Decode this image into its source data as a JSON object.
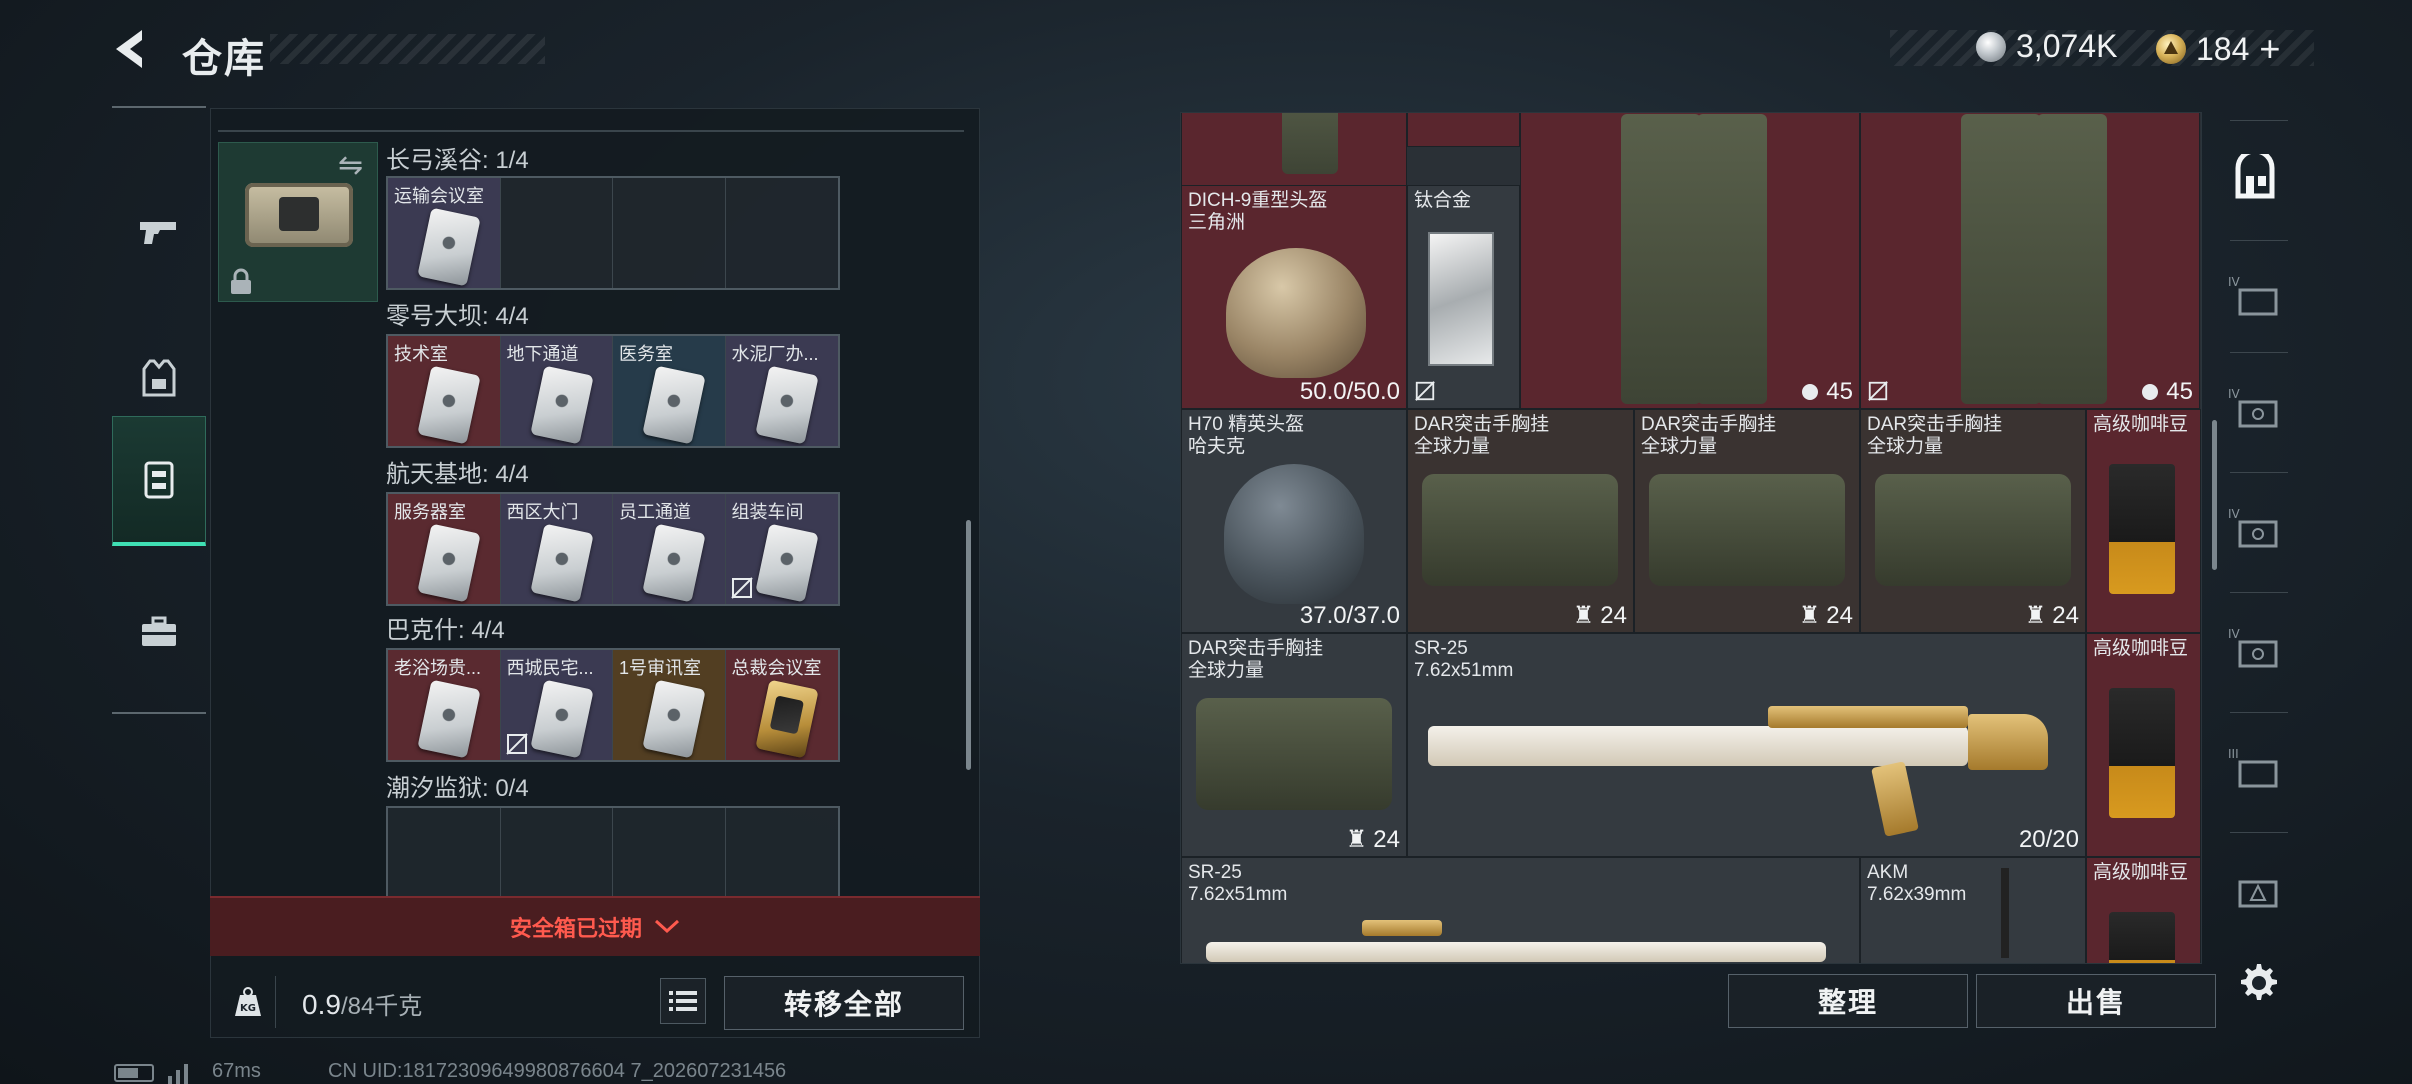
{
  "header": {
    "title": "仓库"
  },
  "currency": {
    "silver": "3,074K",
    "gold": "184",
    "gold_plus": "+"
  },
  "left_tabs": [
    "pistol-tab",
    "armor-tab",
    "safe-case-tab",
    "toolbox-tab"
  ],
  "maps": [
    {
      "label": "长弓溪谷: 1/4",
      "cells": [
        {
          "name": "运输会议室",
          "color": "purple"
        },
        {
          "name": "",
          "color": "empty"
        },
        {
          "name": "",
          "color": "empty"
        },
        {
          "name": "",
          "color": "empty"
        }
      ]
    },
    {
      "label": "零号大坝: 4/4",
      "cells": [
        {
          "name": "技术室",
          "color": "red"
        },
        {
          "name": "地下通道",
          "color": "purple"
        },
        {
          "name": "医务室",
          "color": "blue"
        },
        {
          "name": "水泥厂办...",
          "color": "purple"
        }
      ]
    },
    {
      "label": "航天基地: 4/4",
      "cells": [
        {
          "name": "服务器室",
          "color": "red"
        },
        {
          "name": "西区大门",
          "color": "purple"
        },
        {
          "name": "员工通道",
          "color": "purple"
        },
        {
          "name": "组装车间",
          "color": "purple"
        }
      ]
    },
    {
      "label": "巴克什: 4/4",
      "cells": [
        {
          "name": "老浴场贵...",
          "color": "red"
        },
        {
          "name": "西城民宅...",
          "color": "purple"
        },
        {
          "name": "1号审讯室",
          "color": "gold"
        },
        {
          "name": "总裁会议室",
          "color": "red"
        }
      ]
    },
    {
      "label": "潮汐监狱: 0/4",
      "cells": [
        {
          "name": "",
          "color": "empty"
        },
        {
          "name": "",
          "color": "empty"
        },
        {
          "name": "",
          "color": "empty"
        },
        {
          "name": "",
          "color": "empty"
        }
      ]
    }
  ],
  "expired": {
    "label": "安全箱已过期"
  },
  "weight": {
    "current": "0.9",
    "max": "/84千克",
    "kg_label": "KG"
  },
  "buttons": {
    "transfer_all": "转移全部",
    "sort": "整理",
    "sell": "出售"
  },
  "inventory": {
    "top_count_1": "45",
    "helmet1": {
      "name": "DICH-9重型头盔",
      "sub": "三角洲",
      "durability": "50.0/50.0"
    },
    "titanium": {
      "name": "钛合金"
    },
    "pants1": {
      "count": "45"
    },
    "pants2": {
      "count": "45"
    },
    "helmet2": {
      "name": "H70 精英头盔",
      "sub": "哈夫克",
      "durability": "37.0/37.0"
    },
    "rig1": {
      "name": "DAR突击手胸挂",
      "sub": "全球力量",
      "count": "24"
    },
    "rig2": {
      "name": "DAR突击手胸挂",
      "sub": "全球力量",
      "count": "24"
    },
    "rig3": {
      "name": "DAR突击手胸挂",
      "sub": "全球力量",
      "count": "24"
    },
    "coffee1": {
      "name": "高级咖啡豆"
    },
    "rig4": {
      "name": "DAR突击手胸挂",
      "sub": "全球力量",
      "count": "24"
    },
    "sr25_1": {
      "name": "SR-25",
      "sub": "7.62x51mm",
      "ammo": "20/20"
    },
    "coffee2": {
      "name": "高级咖啡豆"
    },
    "sr25_2": {
      "name": "SR-25",
      "sub": "7.62x51mm"
    },
    "akm": {
      "name": "AKM",
      "sub": "7.62x39mm"
    },
    "coffee3": {
      "name": "高级咖啡豆"
    }
  },
  "right_tabs": [
    "armory-tab",
    "IV",
    "IV",
    "IV",
    "IV",
    "III",
    "storage-tab"
  ],
  "status": {
    "ping": "67ms",
    "uid": "CN UID:18172309649980876604 7_202607231456"
  },
  "colors": {
    "accent": "#3fe0b4",
    "warning": "#ff5a4e",
    "red_slot": "#5a262e"
  }
}
